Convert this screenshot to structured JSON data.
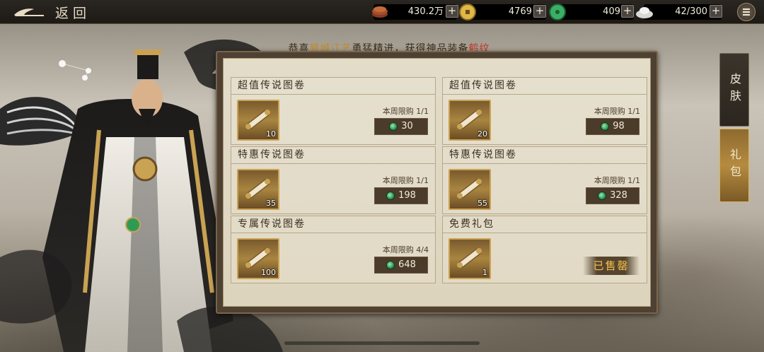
{
  "topbar": {
    "back_label": "返回",
    "resources": [
      {
        "name": "copper-coin-stack",
        "value": "430.2万"
      },
      {
        "name": "gold-coin",
        "value": "4769"
      },
      {
        "name": "jade",
        "value": "409"
      },
      {
        "name": "silver-ingot",
        "value": "42/300"
      }
    ],
    "plus": "+"
  },
  "announcement": {
    "prefix": "恭喜",
    "player": "巽城江艺",
    "middle": "勇猛精进，获得神品装备",
    "item": "鹤纹"
  },
  "cards": [
    {
      "title": "超值传说图卷",
      "qty": "10",
      "limit": "本周限购 1/1",
      "price": "30"
    },
    {
      "title": "超值传说图卷",
      "qty": "20",
      "limit": "本周限购 1/1",
      "price": "98"
    },
    {
      "title": "特惠传说图卷",
      "qty": "35",
      "limit": "本周限购 1/1",
      "price": "198"
    },
    {
      "title": "特惠传说图卷",
      "qty": "55",
      "limit": "本周限购 1/1",
      "price": "328"
    },
    {
      "title": "专属传说图卷",
      "qty": "100",
      "limit": "本周限购 4/4",
      "price": "648"
    },
    {
      "title": "免费礼包",
      "qty": "1",
      "limit": "",
      "price": "",
      "status": "已售罄"
    }
  ],
  "tabs": {
    "skin": "皮肤",
    "gift": "礼包"
  },
  "colors": {
    "accent_gold": "#c9a253",
    "sold_out": "#f5c24a",
    "highlight_name": "#c08a2a",
    "highlight_item": "#c0392b"
  }
}
